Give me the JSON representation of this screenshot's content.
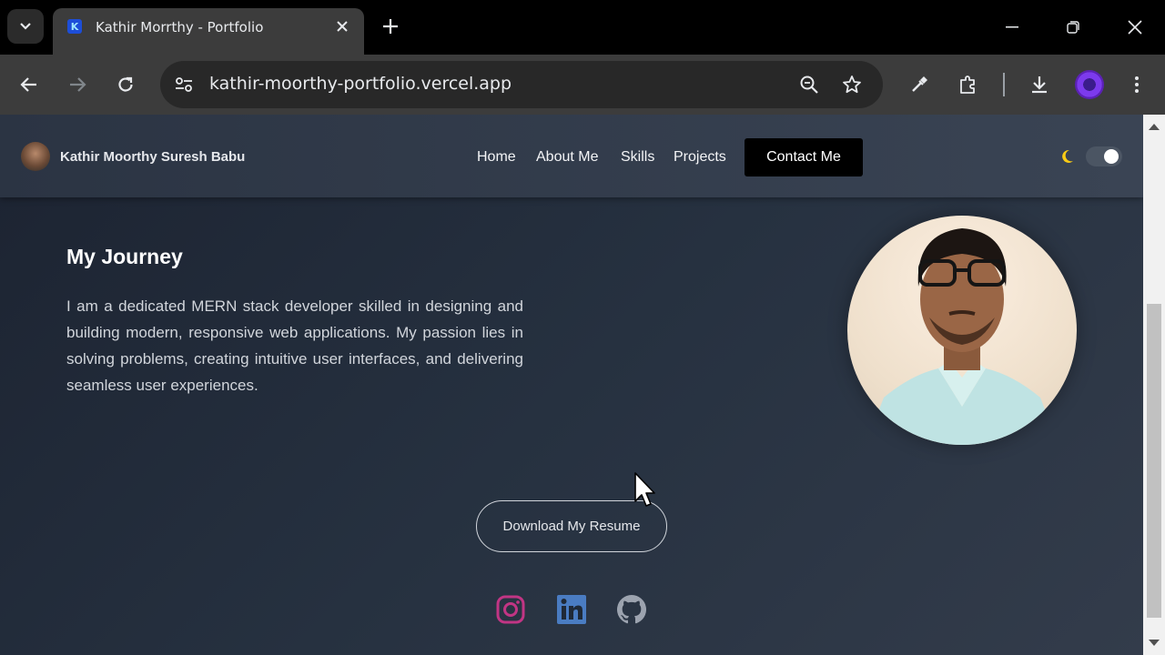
{
  "browser": {
    "tab_title": "Kathir Morrthy - Portfolio",
    "favicon_letter": "K",
    "url": "kathir-moorthy-portfolio.vercel.app"
  },
  "site": {
    "brand_name": "Kathir Moorthy Suresh Babu",
    "nav": [
      "Home",
      "About Me",
      "Skills",
      "Projects"
    ],
    "contact_label": "Contact Me",
    "theme_toggle": "on"
  },
  "about": {
    "title": "My Journey",
    "text": "I am a dedicated MERN stack developer skilled in designing and building modern, responsive web applications. My passion lies in solving problems, creating intuitive user interfaces, and delivering seamless user experiences.",
    "resume_label": "Download My Resume"
  },
  "socials": [
    "instagram-icon",
    "linkedin-icon",
    "github-icon"
  ],
  "colors": {
    "contact_bg": "#000000",
    "page_bg": "#263140",
    "instagram": "#c13584",
    "linkedin": "#0a66c2",
    "github": "#9ca3af"
  }
}
